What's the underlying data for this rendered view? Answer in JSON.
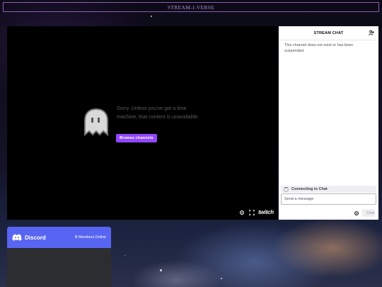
{
  "site": {
    "title": "STREAM-J-VERSE"
  },
  "player": {
    "error_message": "Sorry. Unless you've got a time machine, that content is unavailable.",
    "browse_label": "Browse channels",
    "controls": {
      "settings_icon": "gear-icon",
      "fullscreen_icon": "fullscreen-icon",
      "brand": "twitch"
    }
  },
  "chat": {
    "title": "STREAM CHAT",
    "users_icon": "users-icon",
    "notice": "This channel does not exist or has been suspended.",
    "connecting": "Connecting to Chat",
    "input_placeholder": "Send a message",
    "send_label": "Chat",
    "settings_icon": "gear-icon"
  },
  "discord": {
    "name": "Discord",
    "members_count": "0",
    "members_label": "Members Online"
  },
  "colors": {
    "accent": "#9147ff",
    "discord": "#5865f2",
    "header_border": "#8a5fb0"
  }
}
